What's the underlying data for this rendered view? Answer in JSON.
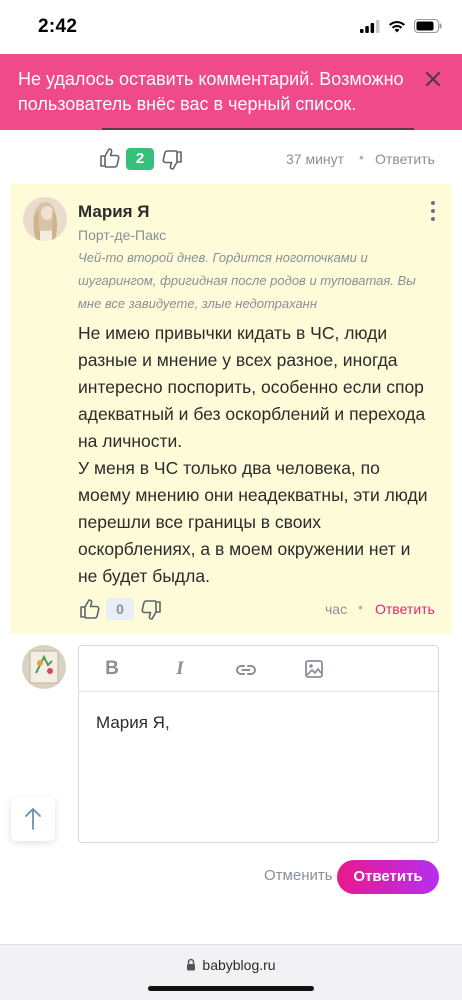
{
  "status_bar": {
    "time": "2:42"
  },
  "error_banner": {
    "message": "Не удалось оставить комментарий. Возможно пользователь внёс вас в черный список."
  },
  "previous_comment": {
    "votes": "2",
    "time": "37 минут",
    "separator": "•",
    "reply_label": "Ответить"
  },
  "comment": {
    "author_name": "Мария Я",
    "author_city": "Порт-де-Пакс",
    "author_status": "Чей-то второй днев. Гордится ноготочками и шугарингом, фригидная после родов и туповатая. Вы мне все завидуете, злые недотраханн",
    "body_paragraphs": [
      "Не имею привычки кидать в ЧС, люди разные и мнение у всех разное, иногда интересно поспорить, особенно если спор адекватный и без оскорблений и перехода на личности.",
      "У меня в ЧС только два человека, по моему мнению они неадекватны, эти люди перешли все границы в своих оскорблениях, а в моем окружении нет и не будет быдла."
    ],
    "votes": "0",
    "time": "час",
    "separator": "•",
    "reply_label": "Ответить"
  },
  "editor": {
    "toolbar": {
      "bold": "B",
      "italic": "I",
      "link_icon": "link-icon",
      "image_icon": "image-icon"
    },
    "text": "Мария Я,"
  },
  "actions": {
    "cancel_label": "Отменить",
    "submit_label": "Ответить"
  },
  "browser": {
    "url": "babyblog.ru"
  },
  "colors": {
    "banner": "#f04a8a",
    "highlight": "#fefcd8",
    "vote_positive": "#36c07a",
    "reply_accent": "#e0287a",
    "submit_gradient_start": "#e8198b",
    "submit_gradient_end": "#b72ef0"
  }
}
